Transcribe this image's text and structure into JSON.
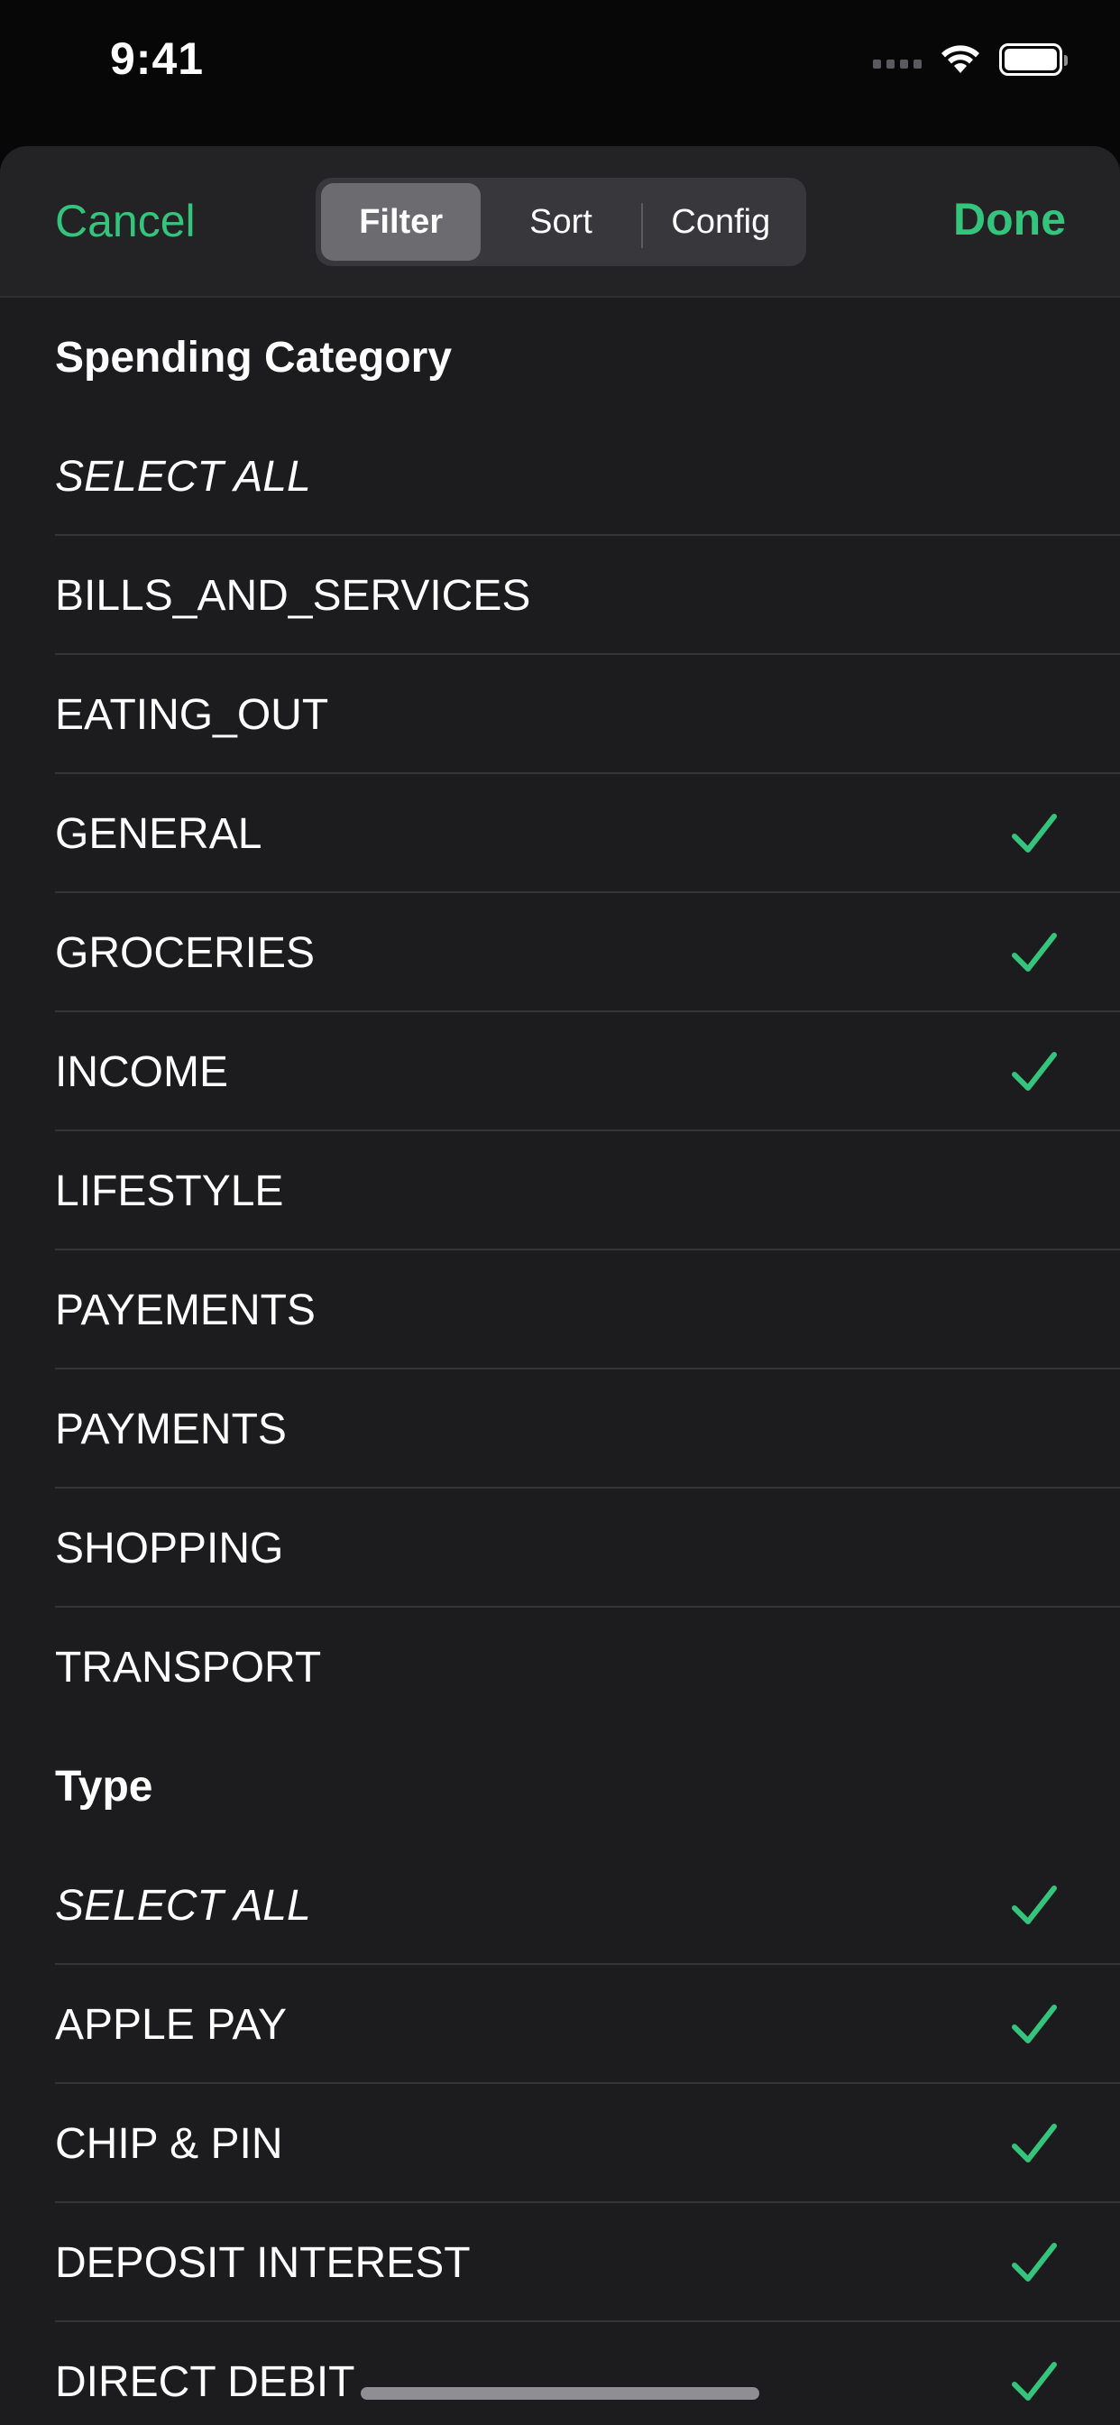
{
  "status_bar": {
    "time": "9:41"
  },
  "nav": {
    "cancel_label": "Cancel",
    "done_label": "Done",
    "segments": [
      "Filter",
      "Sort",
      "Config"
    ],
    "active_segment": "Filter"
  },
  "accent_color": "#34c47c",
  "sections": [
    {
      "title": "Spending Category",
      "rows": [
        {
          "label": "SELECT ALL",
          "checked": false,
          "italic": true
        },
        {
          "label": "BILLS_AND_SERVICES",
          "checked": false
        },
        {
          "label": "EATING_OUT",
          "checked": false
        },
        {
          "label": "GENERAL",
          "checked": true
        },
        {
          "label": "GROCERIES",
          "checked": true
        },
        {
          "label": "INCOME",
          "checked": true
        },
        {
          "label": "LIFESTYLE",
          "checked": false
        },
        {
          "label": "PAYEMENTS",
          "checked": false
        },
        {
          "label": "PAYMENTS",
          "checked": false
        },
        {
          "label": "SHOPPING",
          "checked": false
        },
        {
          "label": "TRANSPORT",
          "checked": false
        }
      ]
    },
    {
      "title": "Type",
      "rows": [
        {
          "label": "SELECT ALL",
          "checked": true,
          "italic": true
        },
        {
          "label": "APPLE PAY",
          "checked": true
        },
        {
          "label": "CHIP & PIN",
          "checked": true
        },
        {
          "label": "DEPOSIT INTEREST",
          "checked": true
        },
        {
          "label": "DIRECT DEBIT",
          "checked": true
        }
      ]
    }
  ]
}
